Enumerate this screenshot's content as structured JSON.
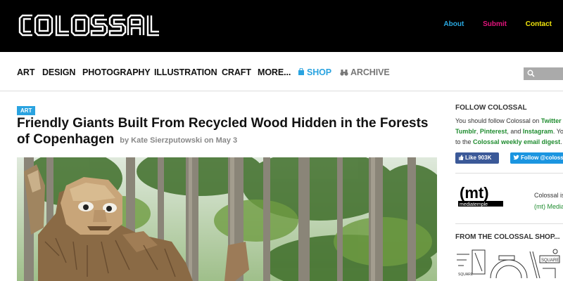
{
  "header": {
    "logo_text": "COLOSSAL",
    "links": [
      {
        "label": "About",
        "color": "#29a8e0"
      },
      {
        "label": "Submit",
        "color": "#e4147d"
      },
      {
        "label": "Contact",
        "color": "#f0e40c"
      }
    ]
  },
  "nav": {
    "items": [
      "ART",
      "DESIGN",
      "PHOTOGRAPHY",
      "ILLUSTRATION",
      "CRAFT",
      "MORE..."
    ],
    "shop_label": "SHOP",
    "archive_label": "ARCHIVE",
    "accent_color": "#2aa3e0"
  },
  "article": {
    "category": "ART",
    "title": "Friendly Giants Built From Recycled Wood Hidden in the Forests of Copenhagen",
    "byline": "by Kate Sierzputowski on May 3"
  },
  "sidebar": {
    "follow_heading": "FOLLOW COLOSSAL",
    "follow_line1": "You should follow Colossal on ",
    "twitter": "Twitter",
    "tumblr": "Tumblr",
    "comma": ", ",
    "pinterest": "Pinterest",
    "and_text": ", and ",
    "instagram": "Instagram",
    "you_text": ". You",
    "to_the": "to the ",
    "digest": "Colossal weekly email digest",
    "period": ".",
    "fb_label": "Like 903K",
    "tw_label": "Follow @colossal",
    "host_line1": "Colossal is hosted",
    "host_line2": "(mt) Media Temple",
    "mt_logo_text": "(mt)",
    "mt_logo_sub": "mediatemple",
    "shop_heading": "FROM THE COLOSSAL SHOP..."
  }
}
